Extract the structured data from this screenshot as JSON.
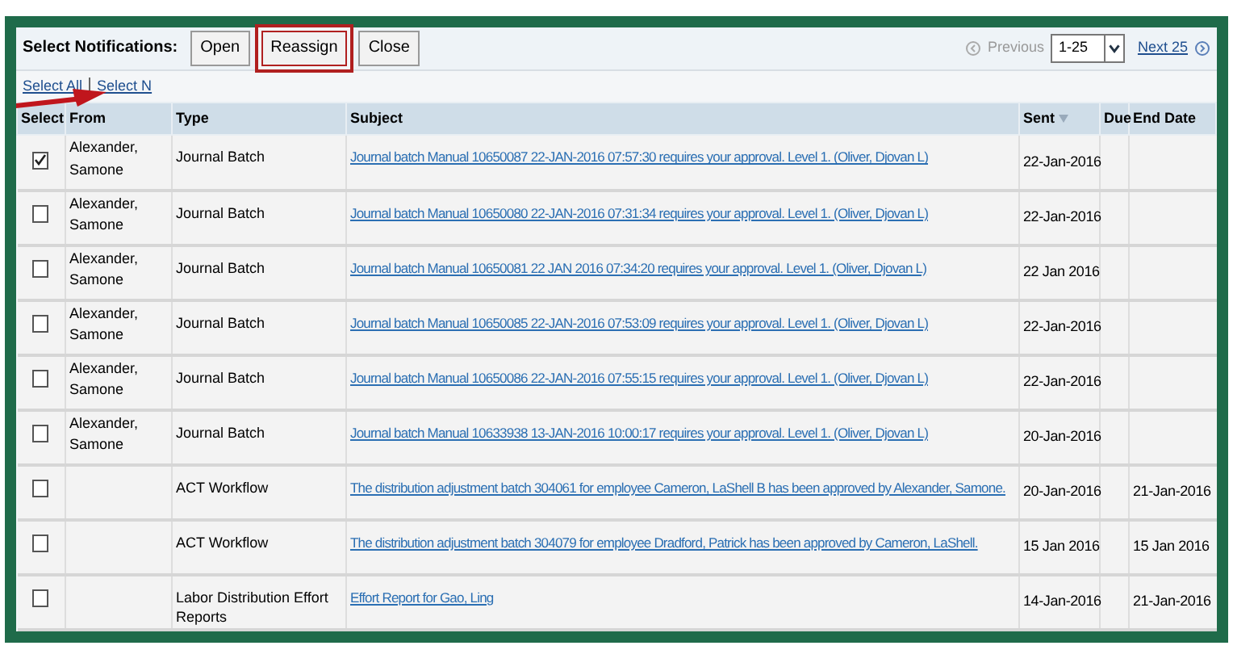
{
  "toolbar": {
    "label": "Select Notifications:",
    "buttons": [
      {
        "label": "Open",
        "highlighted": false
      },
      {
        "label": "Reassign",
        "highlighted": true
      },
      {
        "label": "Close",
        "highlighted": false
      }
    ],
    "previous": "Previous",
    "range": "1-25",
    "next": "Next 25"
  },
  "selection_links": [
    "Select All",
    "Select N"
  ],
  "table": {
    "columns": [
      "Select",
      "From",
      "Type",
      "Subject",
      "Sent",
      "Due",
      "End Date"
    ],
    "rows": [
      {
        "checked": true,
        "from": "Alexander, Samone",
        "type": "Journal Batch",
        "subject": "Journal batch Manual 10650087 22-JAN-2016 07:57:30 requires your approval. Level 1. (Oliver, Djovan L)",
        "sent": "22-Jan-2016",
        "end_date": ""
      },
      {
        "checked": false,
        "from": "Alexander, Samone",
        "type": "Journal Batch",
        "subject": "Journal batch Manual 10650080 22-JAN-2016 07:31:34 requires your approval. Level 1. (Oliver, Djovan L)",
        "sent": "22-Jan-2016",
        "end_date": ""
      },
      {
        "checked": false,
        "from": "Alexander, Samone",
        "type": "Journal Batch",
        "subject": "Journal batch Manual 10650081 22 JAN 2016 07:34:20 requires your approval. Level 1. (Oliver, Djovan L)",
        "sent": "22 Jan 2016",
        "end_date": ""
      },
      {
        "checked": false,
        "from": "Alexander, Samone",
        "type": "Journal Batch",
        "subject": "Journal batch Manual 10650085 22-JAN-2016 07:53:09 requires your approval. Level 1. (Oliver, Djovan L)",
        "sent": "22-Jan-2016",
        "end_date": ""
      },
      {
        "checked": false,
        "from": "Alexander, Samone",
        "type": "Journal Batch",
        "subject": "Journal batch Manual 10650086 22-JAN-2016 07:55:15 requires your approval. Level 1. (Oliver, Djovan L)",
        "sent": "22-Jan-2016",
        "end_date": ""
      },
      {
        "checked": false,
        "from": "Alexander, Samone",
        "type": "Journal Batch",
        "subject": "Journal batch Manual 10633938 13-JAN-2016 10:00:17 requires your approval. Level 1. (Oliver, Djovan L)",
        "sent": "20-Jan-2016",
        "end_date": ""
      },
      {
        "checked": false,
        "from": "",
        "type": "ACT Workflow",
        "subject": "The distribution adjustment batch 304061 for employee Cameron, LaShell B has been approved by Alexander, Samone.",
        "sent": "20-Jan-2016",
        "end_date": "21-Jan-2016"
      },
      {
        "checked": false,
        "from": "",
        "type": "ACT Workflow",
        "subject": "The distribution adjustment batch 304079 for employee Dradford, Patrick has been approved by Cameron, LaShell.",
        "sent": "15 Jan 2016",
        "end_date": "15 Jan 2016"
      },
      {
        "checked": false,
        "from": "",
        "type": "Labor Distribution Effort Reports",
        "subject": "Effort Report for Gao, Ling",
        "sent": "14-Jan-2016",
        "end_date": "21-Jan-2016"
      }
    ]
  }
}
